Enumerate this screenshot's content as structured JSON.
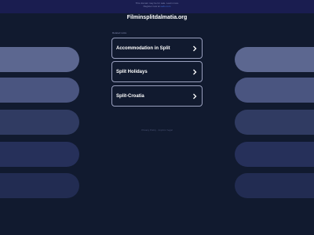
{
  "top_notice": {
    "line1": "This domain may be for sale. Learn more",
    "line2": "Register now at",
    "link": "sedo.com"
  },
  "domain": "Filminsplitdalmatia.org",
  "related_label": "Related Links",
  "links": [
    {
      "label": "Accommodation in Split"
    },
    {
      "label": "Split Holidays"
    },
    {
      "label": "Split-Croatia"
    }
  ],
  "footer": {
    "privacy": "Privacy Policy · Imprint / legal"
  },
  "icons": {
    "chevron": "chevron-right-icon"
  },
  "colors": {
    "background": "#111a2f",
    "topbar": "#1a1d50",
    "side_bar_1": "#5c6790",
    "side_bar_2": "#4a5580",
    "side_bar_3": "#303b62",
    "side_bar_4": "#26305a",
    "side_bar_5": "#222c52"
  }
}
